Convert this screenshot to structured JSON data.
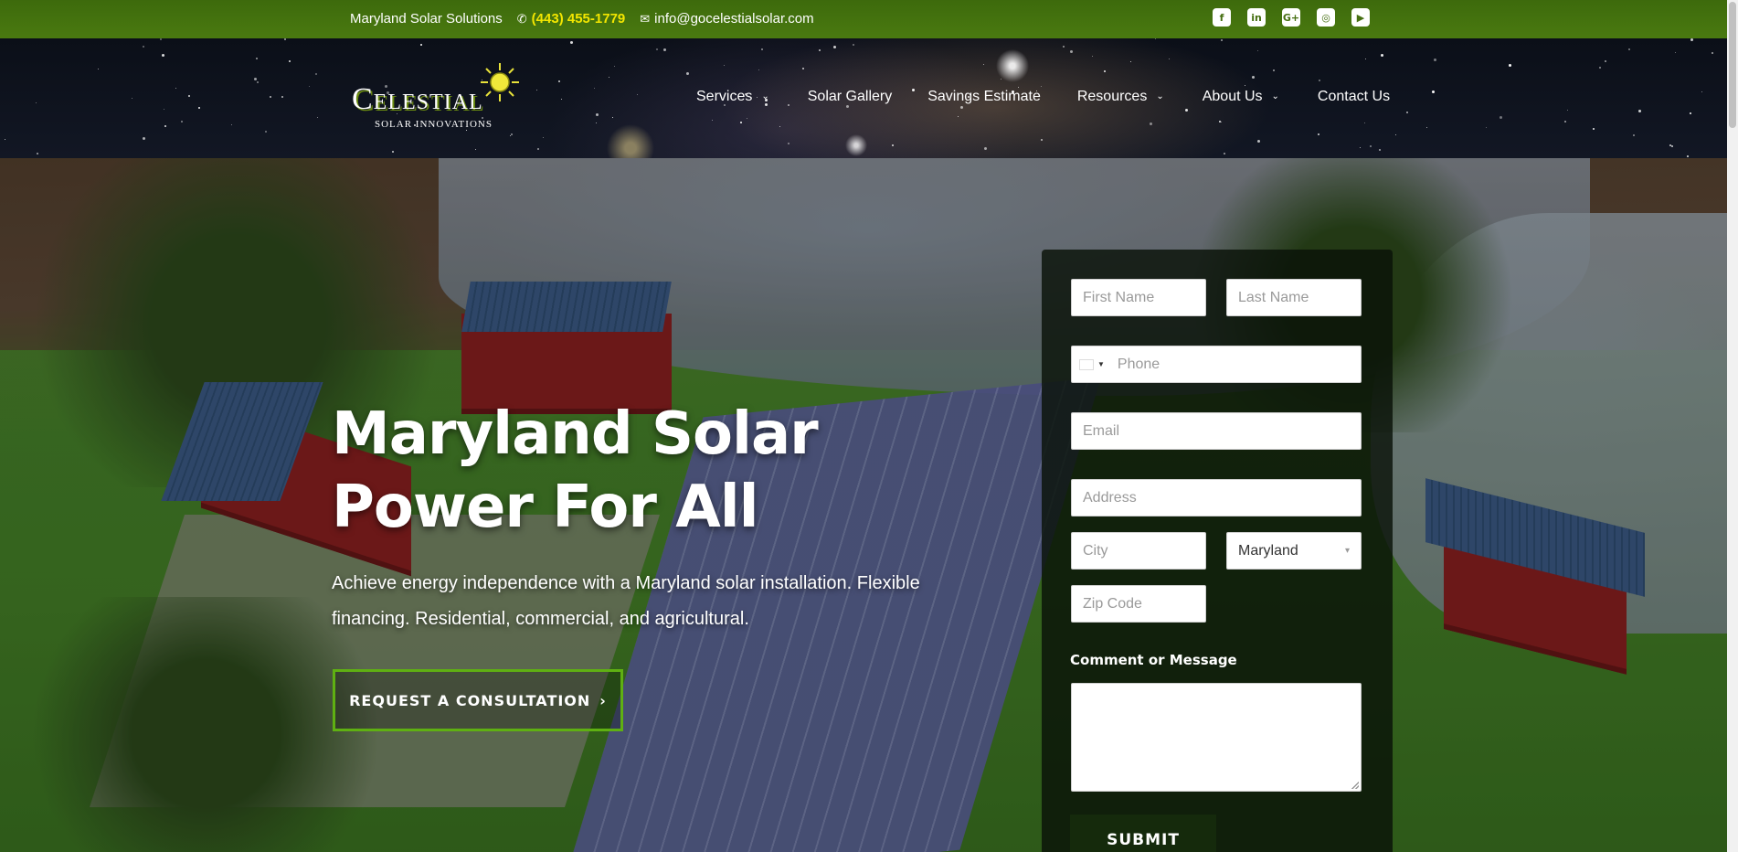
{
  "topbar": {
    "company": "Maryland Solar Solutions",
    "phone": "(443) 455-1779",
    "email": "info@gocelestialsolar.com",
    "phone_icon": "phone-icon",
    "email_icon": "envelope-icon",
    "socials": [
      {
        "name": "facebook-icon",
        "glyph": "f"
      },
      {
        "name": "linkedin-icon",
        "glyph": "in"
      },
      {
        "name": "google-plus-icon",
        "glyph": "G+"
      },
      {
        "name": "instagram-icon",
        "glyph": "◎"
      },
      {
        "name": "youtube-icon",
        "glyph": "▶"
      }
    ]
  },
  "logo": {
    "wordmark": "Celestial",
    "tagline": "SOLAR INNOVATIONS"
  },
  "nav": [
    {
      "label": "Services",
      "has_dropdown": true
    },
    {
      "label": "Solar Gallery",
      "has_dropdown": false
    },
    {
      "label": "Savings Estimate",
      "has_dropdown": false
    },
    {
      "label": "Resources",
      "has_dropdown": true
    },
    {
      "label": "About Us",
      "has_dropdown": true
    },
    {
      "label": "Contact Us",
      "has_dropdown": false
    }
  ],
  "hero": {
    "title": "Maryland Solar Power For All",
    "subtitle": "Achieve energy independence with a Maryland solar installation. Flexible financing. Residential, commercial, and agricultural.",
    "cta_label": "REQUEST A CONSULTATION",
    "cta_icon": "arrow-right-icon"
  },
  "form": {
    "first_name_placeholder": "First Name",
    "last_name_placeholder": "Last Name",
    "phone_placeholder": "Phone",
    "email_placeholder": "Email",
    "address_placeholder": "Address",
    "city_placeholder": "City",
    "state_value": "Maryland",
    "zip_placeholder": "Zip Code",
    "message_label": "Comment or Message",
    "submit_label": "SUBMIT"
  },
  "colors": {
    "topbar_green": "#4a7a10",
    "phone_yellow": "#f3e600",
    "cta_border": "#5fb012"
  }
}
